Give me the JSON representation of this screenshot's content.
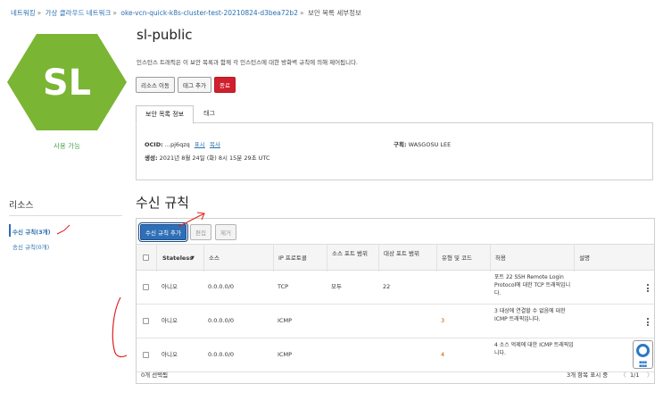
{
  "breadcrumb": {
    "items": [
      "네트워킹",
      "가상 클라우드 네트워크",
      "oke-vcn-quick-k8s-cluster-test-20210824-d3bea72b2",
      "보안 목록 세부정보"
    ],
    "separator": "»"
  },
  "resource_icon": {
    "initials": "SL",
    "color": "#7ab534",
    "status": "사용 가능"
  },
  "header": {
    "title": "sl-public",
    "description": "인스턴스 트래픽은 이 보안 목록과 함께 각 인스턴스에 대한 방화벽 규칙에 의해 제어됩니다."
  },
  "actions": {
    "move": "리소스 이동",
    "add_tags": "태그 추가",
    "terminate": "종료"
  },
  "tabs": [
    "보안 목록 정보",
    "태그"
  ],
  "info": {
    "ocid_label": "OCID:",
    "ocid_value": "...pj6qzq",
    "show": "표시",
    "copy": "복사",
    "created_label": "생성:",
    "created_value": "2021년 8월 24일 (화) 8시 15분 29초 UTC",
    "compartment_label": "구획:",
    "compartment_value": "WASGOSU LEE"
  },
  "resources": {
    "title": "리소스",
    "items": [
      "수신 규칙(3개)",
      "송신 규칙(0개)"
    ]
  },
  "section": {
    "title": "수신 규칙",
    "add_button": "수신 규칙 추가",
    "edit_button": "편집",
    "remove_button": "제거"
  },
  "table": {
    "headers": {
      "stateless": "Stateless",
      "source": "소스",
      "protocol": "IP 프로토콜",
      "src_port": "소스 포트 범위",
      "dst_port": "대상 포트 범위",
      "type_code": "유형 및 코드",
      "allows": "허용",
      "description": "설명"
    },
    "rows": [
      {
        "stateless": "아니오",
        "source": "0.0.0.0/0",
        "protocol": "TCP",
        "src_port": "모두",
        "dst_port": "22",
        "type_code": "",
        "allows": "포트 22 SSH Remote Login Protocol에 대한 TCP 트래픽입니다.",
        "description": ""
      },
      {
        "stateless": "아니오",
        "source": "0.0.0.0/0",
        "protocol": "ICMP",
        "src_port": "",
        "dst_port": "",
        "type_code": "3",
        "allows": "3 대상에 연결할 수 없음에 대한 ICMP 트래픽입니다.",
        "description": ""
      },
      {
        "stateless": "아니오",
        "source": "0.0.0.0/0",
        "protocol": "ICMP",
        "src_port": "",
        "dst_port": "",
        "type_code": "4",
        "allows": "4 소스 억제에 대한 ICMP 트래픽입니다.",
        "description": ""
      }
    ],
    "selected": "0개 선택됨",
    "shown": "3개 항목 표시 중",
    "page": "1/1"
  },
  "colors": {
    "link": "#2a6fb0",
    "danger": "#d0202d",
    "primary": "#2f6fb7",
    "annotation": "#e0201e"
  },
  "icons": [
    "sort-down-icon",
    "kebab-icon",
    "help-lifebuoy-icon",
    "chevron-left-icon",
    "chevron-right-icon"
  ]
}
